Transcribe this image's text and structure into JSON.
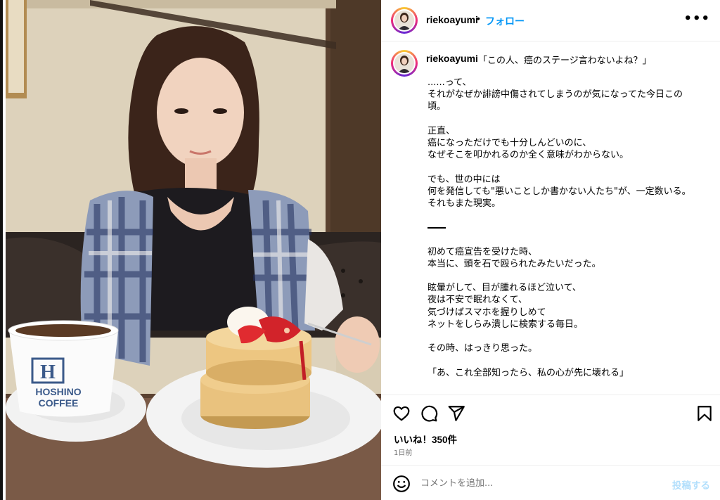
{
  "post": {
    "username": "riekoayumi",
    "follow_label": "フォロー",
    "more_label": "•••"
  },
  "caption": {
    "username": "riekoayumi",
    "first_line": "「この人、癌のステージ言わないよね？」",
    "lines": [
      "......って、",
      "それがなぜか誹謗中傷されてしまうのが気になってた今日この",
      "頃。",
      "",
      "正直、",
      "癌になっただけでも十分しんどいのに、",
      "なぜそこを叩かれるのか全く意味がわからない。",
      "",
      "でも、世の中には",
      "何を発信しても\"悪いことしか書かない人たち\"が、一定数いる。",
      "それもまた現実。",
      "",
      "——",
      "",
      "初めて癌宣告を受けた時、",
      "本当に、頭を石で殴られたみたいだった。",
      "",
      "眩暈がして、目が腫れるほど泣いて、",
      "夜は不安で眠れなくて、",
      "気づけばスマホを握りしめて",
      "ネットをしらみ潰しに検索する毎日。",
      "",
      "その時、はっきり思った。",
      "",
      "「あ、これ全部知ったら、私の心が先に壊れる」"
    ]
  },
  "actions": {
    "likes": "いいね！350件",
    "time": "1日前"
  },
  "comment": {
    "placeholder": "コメントを追加...",
    "post_label": "投稿する"
  },
  "photo": {
    "cup_text_line1": "HOSHINO",
    "cup_text_line2": "COFFEE",
    "cup_logo_letter": "H"
  },
  "colors": {
    "accent": "#0095f6",
    "post_button_disabled": "#b2dffc",
    "muted": "#737373"
  },
  "icons": [
    "heart-icon",
    "comment-icon",
    "send-icon",
    "bookmark-icon",
    "emoji-icon",
    "more-icon"
  ]
}
